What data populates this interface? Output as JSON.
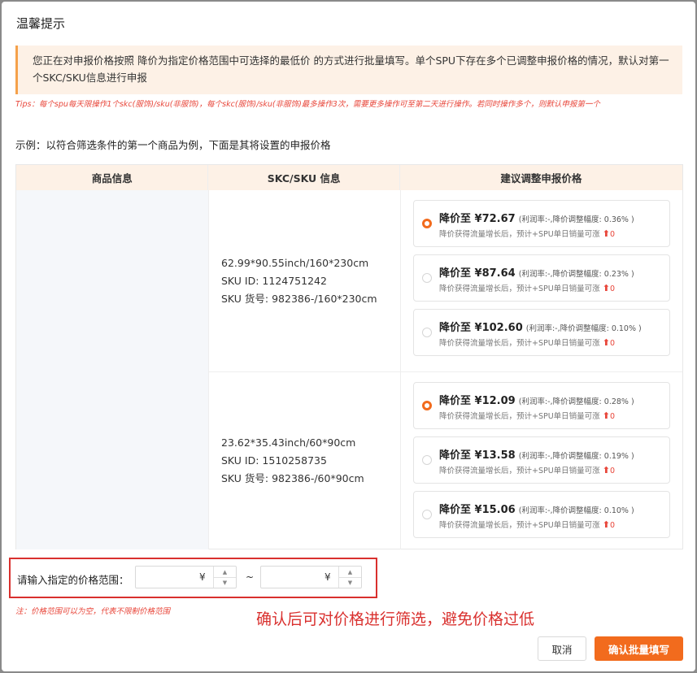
{
  "dialog": {
    "title": "温馨提示",
    "notice": "您正在对申报价格按照 降价为指定价格范围中可选择的最低价 的方式进行批量填写。单个SPU下存在多个已调整申报价格的情况，默认对第一个SKC/SKU信息进行申报",
    "tips": "Tips：每个spu每天限操作1个skc(服饰)/sku(非服饰)，每个skc(服饰)/sku(非服饰)最多操作3次，需要更多操作可至第二天进行操作。若同时操作多个，则默认申报第一个",
    "example": "示例：以符合筛选条件的第一个商品为例，下面是其将设置的申报价格"
  },
  "table": {
    "headers": [
      "商品信息",
      "SKC/SKU 信息",
      "建议调整申报价格"
    ],
    "rows": [
      {
        "spec": "62.99*90.55inch/160*230cm",
        "sku_id": "SKU ID:   1124751242",
        "sku_code": "SKU 货号:   982386-/160*230cm",
        "options": [
          {
            "price": "降价至 ¥72.67",
            "rate": "(利润率:-,降价调整幅度: 0.36% )",
            "sub": "降价获得流量增长后，预计+SPU单日销量可涨",
            "up": "0",
            "selected": true
          },
          {
            "price": "降价至 ¥87.64",
            "rate": "(利润率:-,降价调整幅度: 0.23% )",
            "sub": "降价获得流量增长后，预计+SPU单日销量可涨",
            "up": "0",
            "selected": false
          },
          {
            "price": "降价至 ¥102.60",
            "rate": "(利润率:-,降价调整幅度: 0.10% )",
            "sub": "降价获得流量增长后，预计+SPU单日销量可涨",
            "up": "0",
            "selected": false
          }
        ]
      },
      {
        "spec": "23.62*35.43inch/60*90cm",
        "sku_id": "SKU ID:   1510258735",
        "sku_code": "SKU 货号:   982386-/60*90cm",
        "options": [
          {
            "price": "降价至 ¥12.09",
            "rate": "(利润率:-,降价调整幅度: 0.28% )",
            "sub": "降价获得流量增长后，预计+SPU单日销量可涨",
            "up": "0",
            "selected": true
          },
          {
            "price": "降价至 ¥13.58",
            "rate": "(利润率:-,降价调整幅度: 0.19% )",
            "sub": "降价获得流量增长后，预计+SPU单日销量可涨",
            "up": "0",
            "selected": false
          },
          {
            "price": "降价至 ¥15.06",
            "rate": "(利润率:-,降价调整幅度: 0.10% )",
            "sub": "降价获得流量增长后，预计+SPU单日销量可涨",
            "up": "0",
            "selected": false
          }
        ]
      }
    ]
  },
  "price_range": {
    "label": "请输入指定的价格范围：",
    "min_value": "",
    "max_value": "",
    "currency": "¥",
    "separator": "~",
    "note": "注：价格范围可以为空，代表不限制价格范围"
  },
  "annotation": "确认后可对价格进行筛选，避免价格过低",
  "buttons": {
    "cancel": "取消",
    "confirm": "确认批量填写"
  },
  "icons": {
    "up": "arrow-up-icon",
    "step_up": "chevron-up-icon",
    "step_down": "chevron-down-icon"
  },
  "colors": {
    "accent": "#f26b1d",
    "warning": "#e8463a",
    "highlight_box": "#d9302e",
    "notice_bg": "#fdf1e6"
  }
}
